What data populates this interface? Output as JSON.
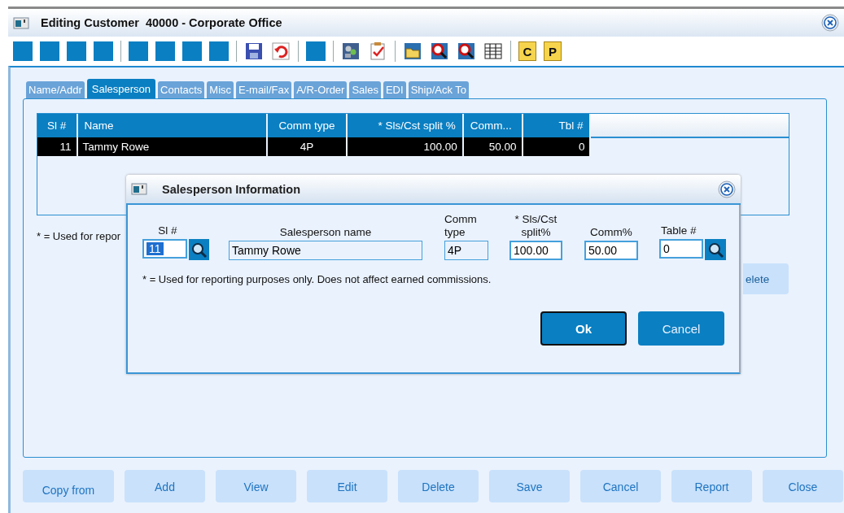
{
  "window": {
    "title": "Editing Customer  40000 - Corporate Office"
  },
  "toolbar": [
    {
      "kind": "blank"
    },
    {
      "kind": "blank"
    },
    {
      "kind": "blank"
    },
    {
      "kind": "blank"
    },
    {
      "kind": "separator"
    },
    {
      "kind": "blank"
    },
    {
      "kind": "blank"
    },
    {
      "kind": "blank"
    },
    {
      "kind": "blank"
    },
    {
      "kind": "separator"
    },
    {
      "kind": "save"
    },
    {
      "kind": "undo"
    },
    {
      "kind": "separator"
    },
    {
      "kind": "blank"
    },
    {
      "kind": "separator"
    },
    {
      "kind": "people"
    },
    {
      "kind": "checklist"
    },
    {
      "kind": "separator"
    },
    {
      "kind": "folder"
    },
    {
      "kind": "find"
    },
    {
      "kind": "find"
    },
    {
      "kind": "grid"
    },
    {
      "kind": "separator"
    },
    {
      "kind": "letter",
      "label": "C"
    },
    {
      "kind": "letter",
      "label": "P"
    }
  ],
  "tabs": [
    {
      "label": "Name/Addr",
      "selected": false
    },
    {
      "label": "Salesperson",
      "selected": true
    },
    {
      "label": "Contacts",
      "selected": false
    },
    {
      "label": "Misc",
      "selected": false
    },
    {
      "label": "E-mail/Fax",
      "selected": false
    },
    {
      "label": "A/R-Order",
      "selected": false
    },
    {
      "label": "Sales",
      "selected": false
    },
    {
      "label": "EDI",
      "selected": false
    },
    {
      "label": "Ship/Ack To",
      "selected": false
    }
  ],
  "table": {
    "columns": [
      "Sl #",
      "Name",
      "Comm type",
      "* Sls/Cst split %",
      "Comm...",
      "Tbl #"
    ],
    "rows": [
      {
        "cells": [
          "11",
          "Tammy Rowe",
          "4P",
          "100.00",
          "50.00",
          "0"
        ],
        "selected": true
      }
    ]
  },
  "footnote": "* = Used for repor",
  "side_button": "elete",
  "buttons": [
    "Copy from",
    "Add",
    "View",
    "Edit",
    "Delete",
    "Save",
    "Cancel",
    "Report",
    "Close"
  ],
  "dialog": {
    "title": "Salesperson Information",
    "fields": [
      {
        "label": "Sl #",
        "value": "11",
        "kind": "lookup",
        "text_selected": true
      },
      {
        "label": "Salesperson name",
        "value": "Tammy Rowe",
        "kind": "readonly",
        "text_selected": false
      },
      {
        "label": "Comm type",
        "value": "4P",
        "kind": "readonly",
        "text_selected": false
      },
      {
        "label": "* Sls/Cst split%",
        "value": "100.00",
        "kind": "edit",
        "text_selected": false
      },
      {
        "label": "Comm%",
        "value": "50.00",
        "kind": "edit",
        "text_selected": false
      },
      {
        "label": "Table #",
        "value": "0",
        "kind": "lookup",
        "text_selected": false
      }
    ],
    "note": "* = Used for reporting purposes only.  Does not affect earned commissions.",
    "buttons": [
      {
        "label": "Ok",
        "default": true
      },
      {
        "label": "Cancel",
        "default": false
      }
    ]
  }
}
